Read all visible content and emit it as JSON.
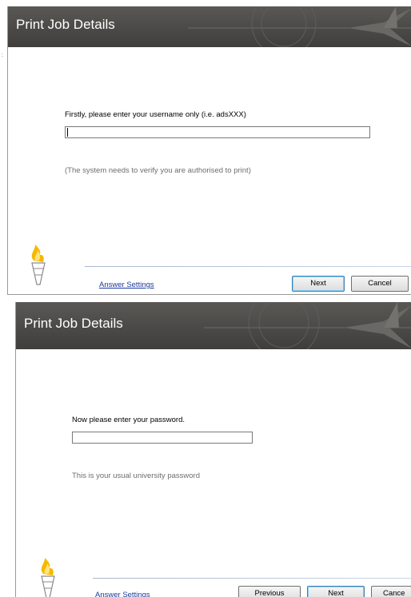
{
  "dialog1": {
    "title": "Print Job Details",
    "prompt": "Firstly, please enter your username only (i.e. adsXXX)",
    "username_value": "",
    "hint": "(The system needs to verify you are authorised  to print)",
    "answer_settings": "Answer Settings",
    "next_label": "Next",
    "cancel_label": "Cancel"
  },
  "dialog2": {
    "title": "Print Job Details",
    "prompt": "Now please enter your password.",
    "password_value": "",
    "hint": "This is your usual university password",
    "answer_settings": "Answer Settings",
    "previous_label": "Previous",
    "next_label": "Next",
    "cancel_label": "Cance"
  },
  "colors": {
    "titlebar": "#4a4846",
    "link": "#1a3a9c",
    "default_button_border": "#3c7fb1",
    "flame": "#f5b800"
  },
  "icons": [
    "torch-logo-icon",
    "compass-star-decoration-icon"
  ]
}
